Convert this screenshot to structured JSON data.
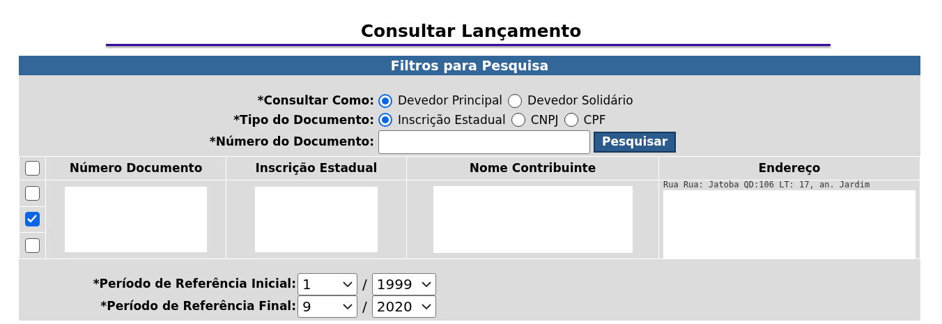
{
  "title": "Consultar Lançamento",
  "filters": {
    "header": "Filtros para Pesquisa",
    "groups": [
      {
        "label": "*Consultar Como:",
        "options": [
          {
            "label": "Devedor Principal",
            "selected": true
          },
          {
            "label": "Devedor Solidário",
            "selected": false
          }
        ]
      },
      {
        "label": "*Tipo do Documento:",
        "options": [
          {
            "label": "Inscrição Estadual",
            "selected": true
          },
          {
            "label": "CNPJ",
            "selected": false
          },
          {
            "label": "CPF",
            "selected": false
          }
        ]
      }
    ],
    "document_number": {
      "label": "*Número do Documento:"
    },
    "search_button": "Pesquisar"
  },
  "table": {
    "select_all": {
      "checked": false
    },
    "columns": [
      "Número Documento",
      "Inscrição Estadual",
      "Nome Contribuinte",
      "Endereço"
    ],
    "rows": [
      {
        "checked": false,
        "address": "Rua Rua: Jatoba QD:106 LT: 17, an. Jardim"
      },
      {
        "checked": true
      },
      {
        "checked": false
      }
    ]
  },
  "periods": [
    {
      "label": "*Período de Referência Inicial:",
      "month": "1",
      "separator": "/",
      "year": "1999"
    },
    {
      "label": "*Período de Referência Final:",
      "month": "9",
      "separator": "/",
      "year": "2020"
    }
  ]
}
